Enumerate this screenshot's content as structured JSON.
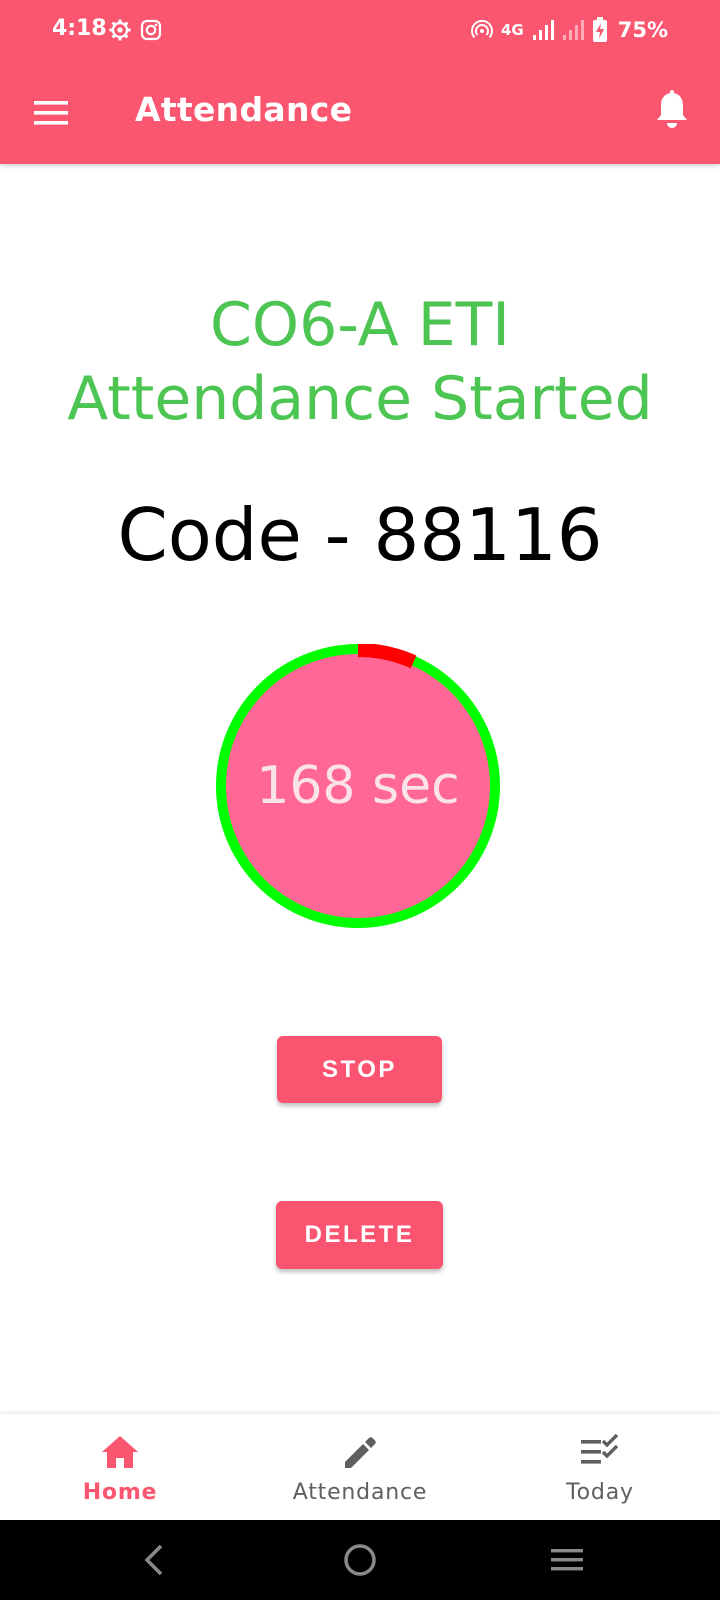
{
  "status_bar": {
    "time": "4:18",
    "network": "4G",
    "battery": "75%",
    "icons": [
      "settings-gear-icon",
      "instagram-icon",
      "hotspot-icon",
      "signal-icon",
      "battery-charging-icon"
    ]
  },
  "app_bar": {
    "title": "Attendance",
    "menu_icon": "hamburger-menu-icon",
    "notification_icon": "bell-icon"
  },
  "main": {
    "subject": "CO6-A ETI",
    "status": "Attendance Started",
    "code_text": "Code - 88116",
    "timer": {
      "label": "168 sec",
      "remaining_fraction": 0.933
    },
    "stop_label": "STOP",
    "delete_label": "DELETE"
  },
  "bottom_nav": {
    "items": [
      {
        "label": "Home",
        "icon": "home-icon",
        "active": true
      },
      {
        "label": "Attendance",
        "icon": "pencil-icon",
        "active": false
      },
      {
        "label": "Today",
        "icon": "checklist-icon",
        "active": false
      }
    ]
  },
  "colors": {
    "primary": "#fa566f",
    "headline_green": "#4cc552",
    "timer_fill": "#ff6797",
    "timer_ring_remaining": "#00ff00",
    "timer_ring_elapsed": "#ff0000"
  }
}
